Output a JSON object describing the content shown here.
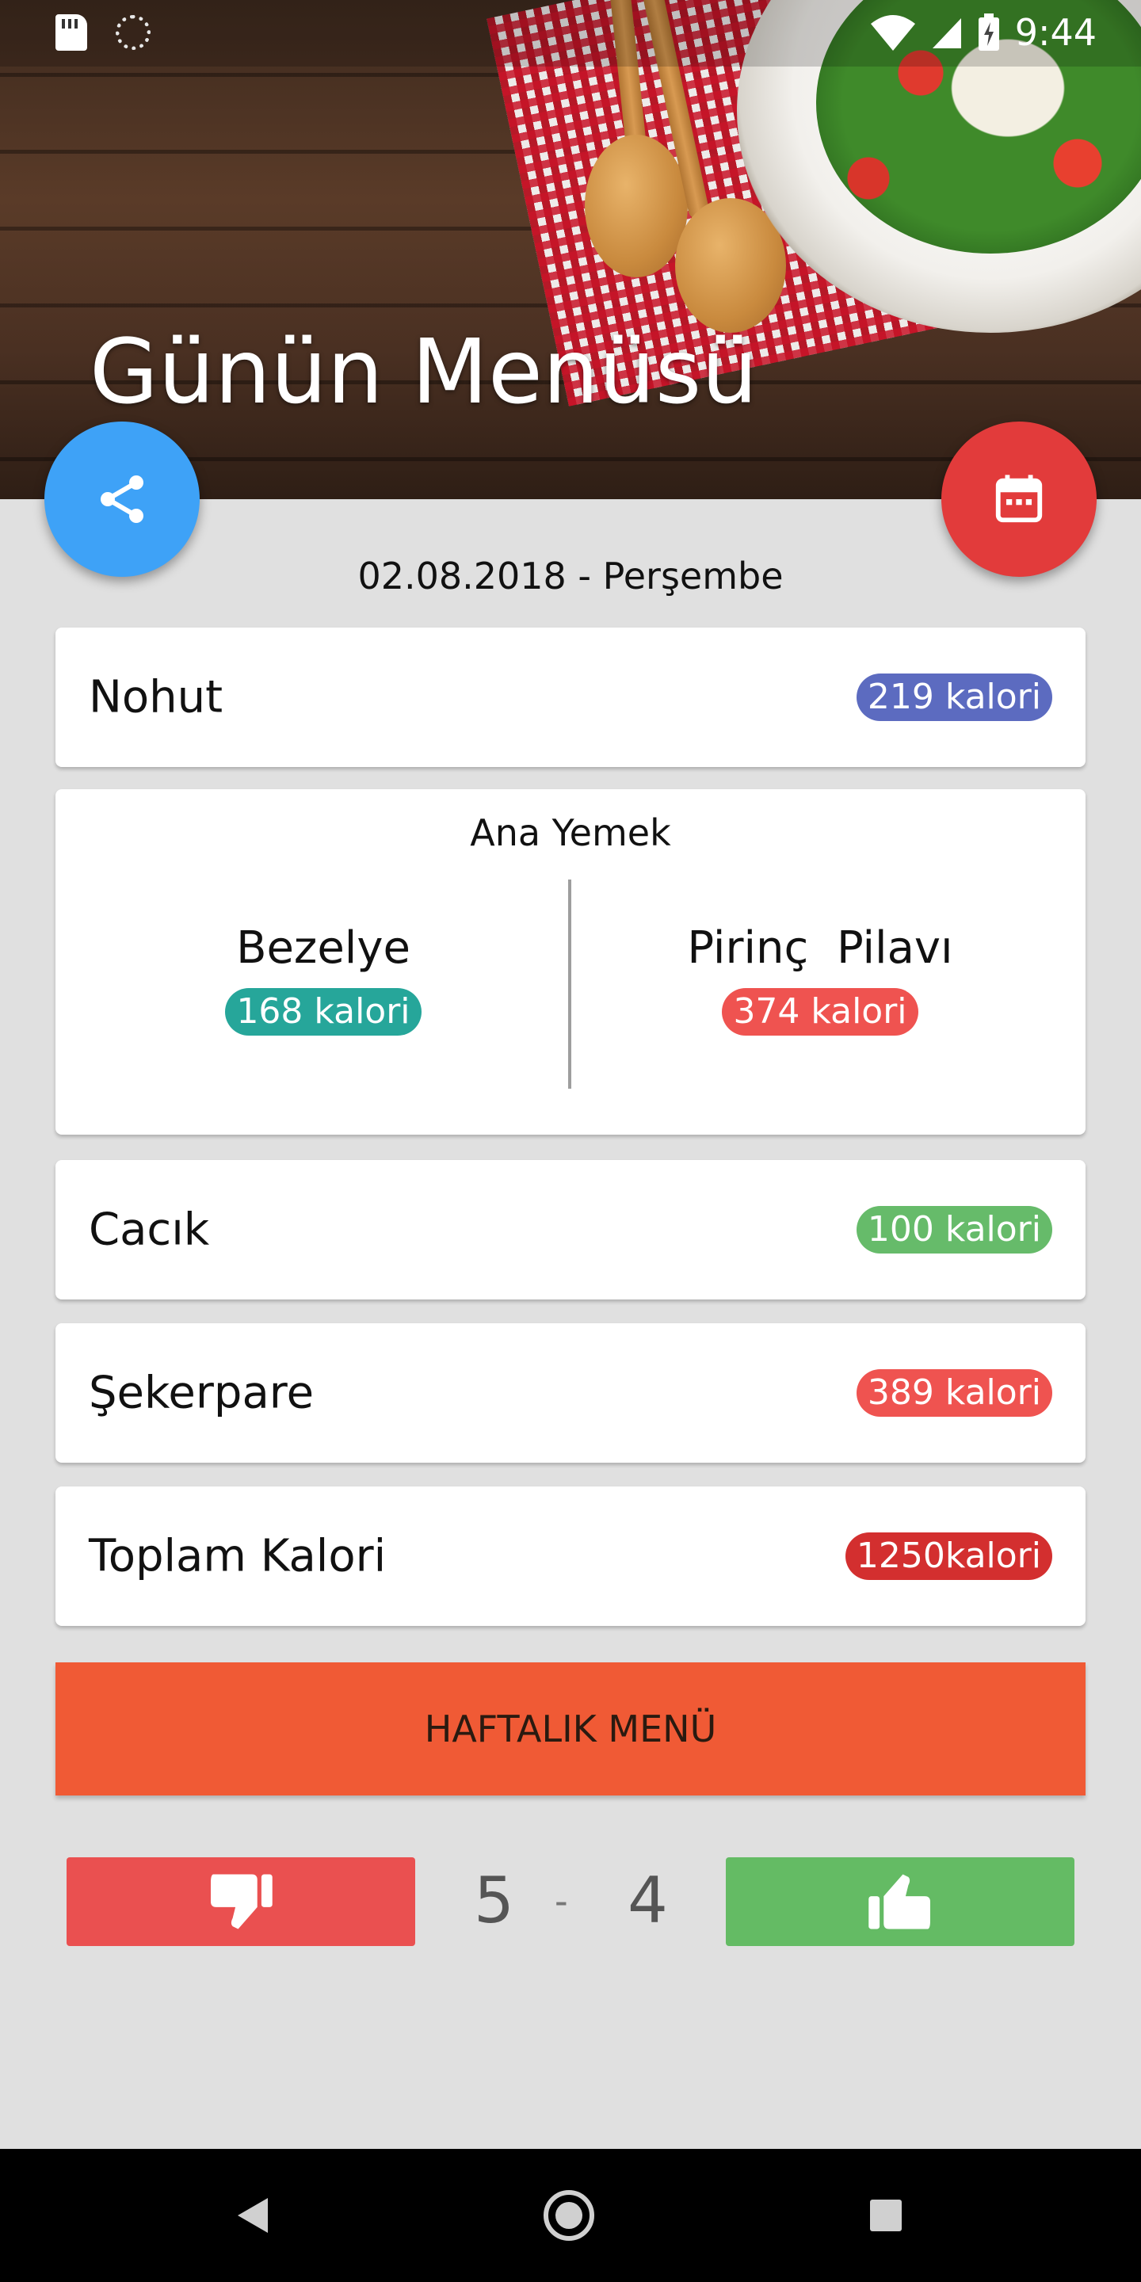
{
  "status_bar": {
    "time": "9:44",
    "icons": [
      "sd-card-icon",
      "loader-icon",
      "wifi-icon",
      "signal-icon",
      "battery-charging-icon"
    ]
  },
  "header": {
    "title": "Günün Menüsü"
  },
  "date": "02.08.2018 - Perşembe",
  "menu": {
    "soup": {
      "name": "Nohut",
      "calories": "219 kalori",
      "badge_color": "#5c6bc0"
    },
    "main_course": {
      "title": "Ana Yemek",
      "left": {
        "name": "Bezelye",
        "calories": "168 kalori",
        "badge_color": "#26a69a"
      },
      "right": {
        "name": "Pirinç  Pilavı",
        "calories": "374 kalori",
        "badge_color": "#ef5350"
      }
    },
    "side": {
      "name": "Cacık",
      "calories": "100 kalori",
      "badge_color": "#66bb6a"
    },
    "dessert": {
      "name": "Şekerpare",
      "calories": "389 kalori",
      "badge_color": "#ef5350"
    },
    "total": {
      "name": "Toplam Kalori",
      "calories": "1250kalori",
      "badge_color": "#d32f2f"
    }
  },
  "weekly_button": {
    "label": "HAFTALIK MENÜ",
    "color": "#f05a35"
  },
  "votes": {
    "dislike_count": "5",
    "separator": "-",
    "like_count": "4",
    "dislike_color": "#ea5050",
    "like_color": "#64bb64"
  },
  "fabs": {
    "share_color": "#3ea2f7",
    "calendar_color": "#e23b3b"
  }
}
